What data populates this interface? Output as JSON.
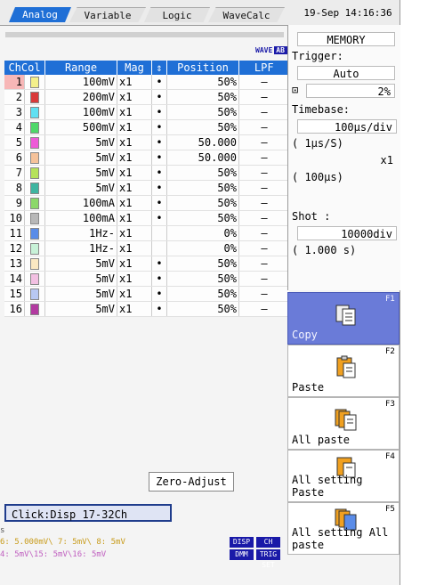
{
  "tabs": [
    {
      "label": "Analog",
      "active": true
    },
    {
      "label": "Variable",
      "active": false
    },
    {
      "label": "Logic",
      "active": false
    },
    {
      "label": "WaveCalc",
      "active": false
    }
  ],
  "datetime": "19-Sep 14:16:36",
  "wave_badge": {
    "text": "WAVE",
    "sub": "AB CSR"
  },
  "table": {
    "headers": [
      "ChCol",
      "Range",
      "Mag",
      "⇕",
      "Position",
      "LPF"
    ],
    "rows": [
      {
        "ch": "1",
        "color": "#f4f08a",
        "range": "100mV",
        "mag": "x1",
        "dot": "•",
        "pos": "50%",
        "lpf": "–"
      },
      {
        "ch": "2",
        "color": "#d93a3a",
        "range": "200mV",
        "mag": "x1",
        "dot": "•",
        "pos": "50%",
        "lpf": "–"
      },
      {
        "ch": "3",
        "color": "#5fe0f2",
        "range": "100mV",
        "mag": "x1",
        "dot": "•",
        "pos": "50%",
        "lpf": "–"
      },
      {
        "ch": "4",
        "color": "#4fd86a",
        "range": "500mV",
        "mag": "x1",
        "dot": "•",
        "pos": "50%",
        "lpf": "–"
      },
      {
        "ch": "5",
        "color": "#ee5ad8",
        "range": "5mV",
        "mag": "x1",
        "dot": "•",
        "pos": "50.000",
        "lpf": "–"
      },
      {
        "ch": "6",
        "color": "#f5c29a",
        "range": "5mV",
        "mag": "x1",
        "dot": "•",
        "pos": "50.000",
        "lpf": "–"
      },
      {
        "ch": "7",
        "color": "#b6e25a",
        "range": "5mV",
        "mag": "x1",
        "dot": "•",
        "pos": "50%",
        "lpf": "–"
      },
      {
        "ch": "8",
        "color": "#3fb5a0",
        "range": "5mV",
        "mag": "x1",
        "dot": "•",
        "pos": "50%",
        "lpf": "–"
      },
      {
        "ch": "9",
        "color": "#8cd86a",
        "range": "100mA",
        "mag": "x1",
        "dot": "•",
        "pos": "50%",
        "lpf": "–"
      },
      {
        "ch": "10",
        "color": "#b8b8b8",
        "range": "100mA",
        "mag": "x1",
        "dot": "•",
        "pos": "50%",
        "lpf": "–"
      },
      {
        "ch": "11",
        "color": "#5a8ce8",
        "range": "1Hz-",
        "mag": "x1",
        "dot": "",
        "pos": "0%",
        "lpf": "–"
      },
      {
        "ch": "12",
        "color": "#c8f2d8",
        "range": "1Hz-",
        "mag": "x1",
        "dot": "",
        "pos": "0%",
        "lpf": "–"
      },
      {
        "ch": "13",
        "color": "#fae8c2",
        "range": "5mV",
        "mag": "x1",
        "dot": "•",
        "pos": "50%",
        "lpf": "–"
      },
      {
        "ch": "14",
        "color": "#f2c0e2",
        "range": "5mV",
        "mag": "x1",
        "dot": "•",
        "pos": "50%",
        "lpf": "–"
      },
      {
        "ch": "15",
        "color": "#b8c8f2",
        "range": "5mV",
        "mag": "x1",
        "dot": "•",
        "pos": "50%",
        "lpf": "–"
      },
      {
        "ch": "16",
        "color": "#b23aa0",
        "range": "5mV",
        "mag": "x1",
        "dot": "•",
        "pos": "50%",
        "lpf": "–"
      }
    ]
  },
  "zero_adjust": "Zero-Adjust",
  "click_disp": "Click:Disp 17-32Ch",
  "status": {
    "row0": "s",
    "row1": "6:  5.000mV\\ 7:        5mV\\ 8:        5mV",
    "row2": "4:        5mV\\15:        5mV\\16:        5mV",
    "btn_disp": "DISP",
    "btn_ch_set": "CH SET",
    "btn_dmm": "DMM",
    "btn_trig_set": "TRIG SET"
  },
  "right_panel": {
    "mode": "MEMORY",
    "trigger_label": "Trigger:",
    "trigger_value": "Auto",
    "pretrig_icon": "pretrigger-icon",
    "pretrig_value": "2%",
    "timebase_label": "Timebase:",
    "timebase_value": "100µs/div",
    "sample_value": "( 1µs/S)",
    "mag_value": "x1",
    "span_value": "( 100µs)",
    "shot_label": "Shot   :",
    "shot_value": "10000div",
    "shot_time": "( 1.000 s)"
  },
  "fkeys": [
    {
      "num": "F1",
      "label": "Copy",
      "active": true,
      "icon": "copy-icon"
    },
    {
      "num": "F2",
      "label": "Paste",
      "active": false,
      "icon": "paste-icon"
    },
    {
      "num": "F3",
      "label": "All paste",
      "active": false,
      "icon": "all-paste-icon"
    },
    {
      "num": "F4",
      "label": "All setting Paste",
      "active": false,
      "icon": "all-setting-paste-icon"
    },
    {
      "num": "F5",
      "label": "All setting All paste",
      "active": false,
      "icon": "all-setting-all-paste-icon"
    }
  ],
  "colors": {
    "accent": "#1f6fd6",
    "fkey_active": "#6a7bd8",
    "selection": "#f7b7b7"
  }
}
